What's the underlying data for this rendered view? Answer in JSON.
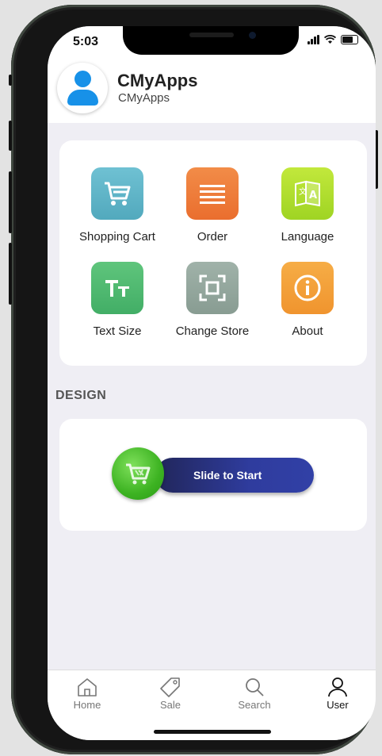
{
  "status": {
    "time": "5:03"
  },
  "user": {
    "name": "CMyApps",
    "subtitle": "CMyApps"
  },
  "menu": {
    "items": [
      {
        "label": "Shopping Cart",
        "icon": "cart-icon",
        "color": "#5fb6c8"
      },
      {
        "label": "Order",
        "icon": "list-icon",
        "color": "#ef7d3c"
      },
      {
        "label": "Language",
        "icon": "translate-icon",
        "color": "#b2e02e"
      },
      {
        "label": "Text Size",
        "icon": "text-size-icon",
        "color": "#4fba70"
      },
      {
        "label": "Change Store",
        "icon": "scan-icon",
        "color": "#93a79e"
      },
      {
        "label": "About",
        "icon": "info-icon",
        "color": "#f4a23a"
      }
    ]
  },
  "design": {
    "title": "DESIGN",
    "slider_label": "Slide to Start"
  },
  "tabbar": {
    "items": [
      {
        "label": "Home",
        "icon": "home-icon"
      },
      {
        "label": "Sale",
        "icon": "tag-icon"
      },
      {
        "label": "Search",
        "icon": "search-icon"
      },
      {
        "label": "User",
        "icon": "user-icon",
        "active": true
      }
    ]
  }
}
